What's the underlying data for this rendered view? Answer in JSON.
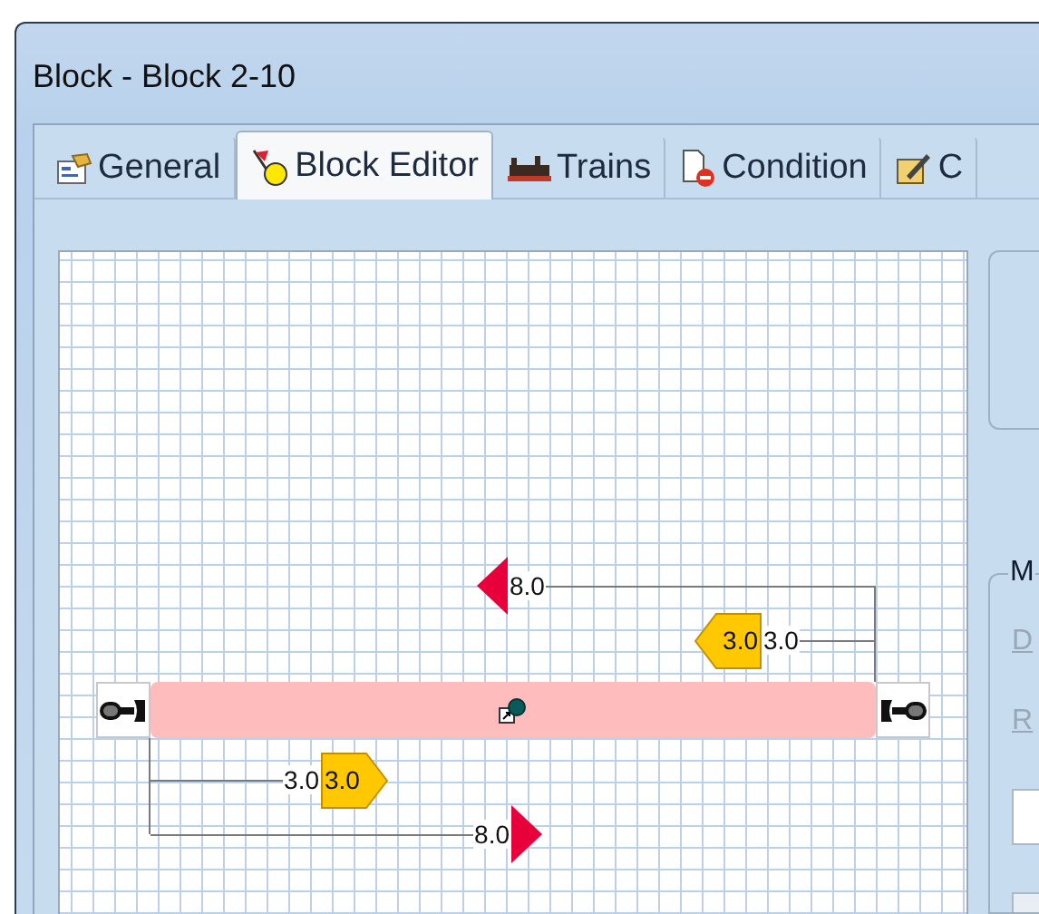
{
  "window": {
    "title": "Block - Block 2-10"
  },
  "tabs": [
    {
      "label": "General",
      "selected": false
    },
    {
      "label": "Block Editor",
      "selected": true
    },
    {
      "label": "Trains",
      "selected": false
    },
    {
      "label": "Condition",
      "selected": false
    },
    {
      "label": "C",
      "selected": false
    }
  ],
  "editor": {
    "markers": [
      {
        "kind": "stop",
        "above_block": true,
        "distance": "8.0"
      },
      {
        "kind": "speed",
        "above_block": true,
        "distance": "3.0",
        "speed": "3.0"
      },
      {
        "kind": "speed",
        "above_block": false,
        "distance": "3.0",
        "speed": "3.0"
      },
      {
        "kind": "stop",
        "above_block": false,
        "distance": "8.0"
      }
    ]
  },
  "side_panel": {
    "group_title": "M",
    "fields": [
      {
        "label": "D",
        "disabled": true
      },
      {
        "label": "R",
        "disabled": true
      }
    ]
  }
}
